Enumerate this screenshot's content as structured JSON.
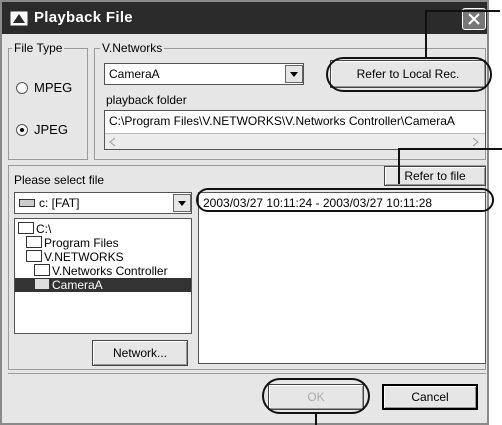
{
  "window": {
    "title": "Playback File"
  },
  "file_type": {
    "legend": "File Type",
    "options": [
      {
        "label": "MPEG",
        "selected": false
      },
      {
        "label": "JPEG",
        "selected": true
      }
    ]
  },
  "vnetworks": {
    "legend": "V.Networks",
    "camera_value": "CameraA",
    "refer_local_label": "Refer to Local Rec.",
    "playback_folder_label": "playback folder",
    "playback_folder_value": "C:\\Program Files\\V.NETWORKS\\V.Networks Controller\\CameraA"
  },
  "file_section": {
    "prompt": "Please select file",
    "drive_value": "c: [FAT]",
    "refer_file_label": "Refer to file",
    "tree": [
      {
        "label": "C:\\",
        "selected": false
      },
      {
        "label": "Program Files",
        "selected": false
      },
      {
        "label": "V.NETWORKS",
        "selected": false
      },
      {
        "label": "V.Networks Controller",
        "selected": false
      },
      {
        "label": "CameraA",
        "selected": true
      }
    ],
    "files": [
      "2003/03/27 10:11:24 - 2003/03/27 10:11:28"
    ],
    "network_label": "Network..."
  },
  "footer": {
    "ok_label": "OK",
    "cancel_label": "Cancel"
  }
}
